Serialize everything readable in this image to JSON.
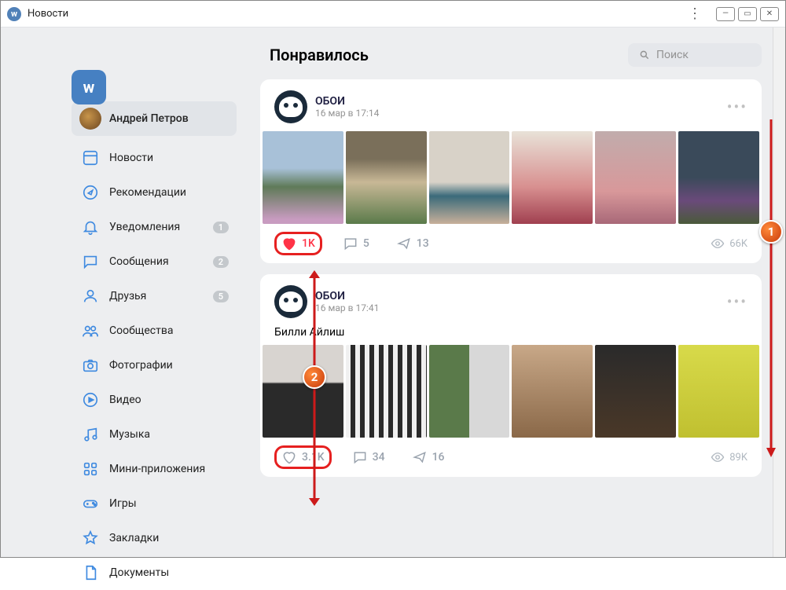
{
  "titlebar": {
    "title": "Новости"
  },
  "logo_text": "w",
  "user": {
    "name": "Андрей Петров"
  },
  "nav": {
    "news": "Новости",
    "recommendations": "Рекомендации",
    "notifications": "Уведомления",
    "messages": "Сообщения",
    "friends": "Друзья",
    "communities": "Сообщества",
    "photos": "Фотографии",
    "video": "Видео",
    "music": "Музыка",
    "miniapps": "Мини-приложения",
    "games": "Игры",
    "bookmarks": "Закладки",
    "documents": "Документы"
  },
  "badges": {
    "notifications": "1",
    "messages": "2",
    "friends": "5"
  },
  "header": {
    "title": "Понравилось"
  },
  "search": {
    "placeholder": "Поиск"
  },
  "posts": [
    {
      "author": "ОБОИ",
      "date": "16 мар в 17:14",
      "likes": "1K",
      "comments": "5",
      "shares": "13",
      "views": "66K",
      "liked": true
    },
    {
      "author": "ОБОИ",
      "date": "16 мар в 17:41",
      "text": "Билли Айлиш",
      "likes": "3.1K",
      "comments": "34",
      "shares": "16",
      "views": "89K",
      "liked": false
    }
  ],
  "callouts": {
    "c1": "1",
    "c2": "2"
  }
}
